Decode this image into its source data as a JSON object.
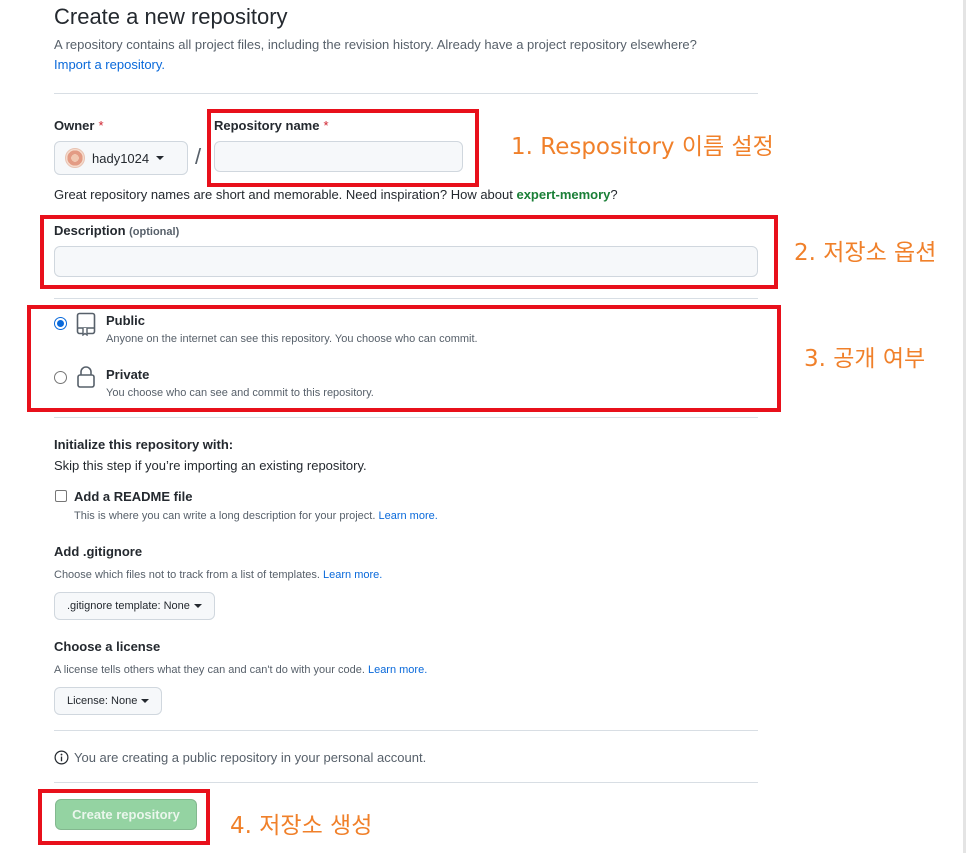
{
  "header": {
    "title": "Create a new repository",
    "subtitle": "A repository contains all project files, including the revision history. Already have a project repository elsewhere?",
    "import_link": "Import a repository."
  },
  "owner": {
    "label": "Owner",
    "required_mark": "*",
    "selected": "hady1024"
  },
  "repo_name": {
    "label": "Repository name",
    "required_mark": "*",
    "value": "",
    "separator": "/"
  },
  "name_hint": {
    "prefix": "Great repository names are short and memorable. Need inspiration? How about ",
    "suggestion": "expert-memory",
    "suffix": "?"
  },
  "description": {
    "label": "Description",
    "optional": "(optional)",
    "value": ""
  },
  "visibility": {
    "selected": "public",
    "options": [
      {
        "id": "public",
        "label": "Public",
        "desc": "Anyone on the internet can see this repository. You choose who can commit."
      },
      {
        "id": "private",
        "label": "Private",
        "desc": "You choose who can see and commit to this repository."
      }
    ]
  },
  "init": {
    "title": "Initialize this repository with:",
    "subtitle": "Skip this step if you’re importing an existing repository.",
    "readme_label": "Add a README file",
    "readme_checked": false,
    "readme_desc": "This is where you can write a long description for your project.",
    "learn_more": "Learn more."
  },
  "gitignore": {
    "title": "Add .gitignore",
    "desc": "Choose which files not to track from a list of templates.",
    "learn_more": "Learn more.",
    "button": ".gitignore template: None"
  },
  "license": {
    "title": "Choose a license",
    "desc": "A license tells others what they can and can't do with your code.",
    "learn_more": "Learn more.",
    "button": "License: None"
  },
  "notice": "You are creating a public repository in your personal account.",
  "submit": {
    "label": "Create repository"
  },
  "annotations": [
    "1. Respository 이름 설정",
    "2. 저장소 옵션",
    "3. 공개 여부",
    "4. 저장소 생성"
  ],
  "colors": {
    "highlight_box": "#e8101b",
    "annotation_text": "#f0802a",
    "link": "#0969da",
    "suggestion": "#1a7f37",
    "create_button": "#94d3a2"
  }
}
